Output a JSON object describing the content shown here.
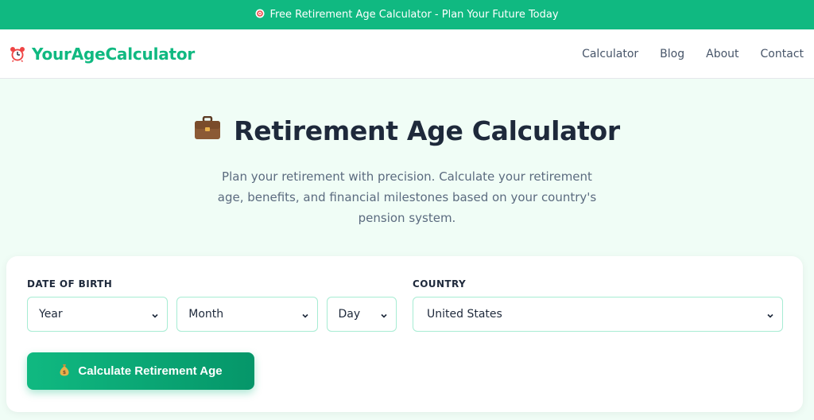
{
  "banner": {
    "icon": "target-icon",
    "text": "Free Retirement Age Calculator - Plan Your Future Today"
  },
  "nav": {
    "logo_text": "YourAgeCalculator",
    "logo_icon": "alarm-clock-icon",
    "links": [
      "Calculator",
      "Blog",
      "About",
      "Contact"
    ]
  },
  "hero": {
    "icon": "briefcase-icon",
    "title": "Retirement Age Calculator",
    "description": "Plan your retirement with precision. Calculate your retirement age, benefits, and financial milestones based on your country's pension system."
  },
  "form": {
    "dob_label": "DATE OF BIRTH",
    "year_value": "Year",
    "month_value": "Month",
    "day_value": "Day",
    "country_label": "COUNTRY",
    "country_value": "United States",
    "submit_label": "Calculate Retirement Age",
    "submit_icon": "money-bag-icon"
  },
  "colors": {
    "accent": "#10b981",
    "accent_dark": "#059669",
    "text": "#1e293b",
    "hero_bg": "#f0fdf6"
  }
}
